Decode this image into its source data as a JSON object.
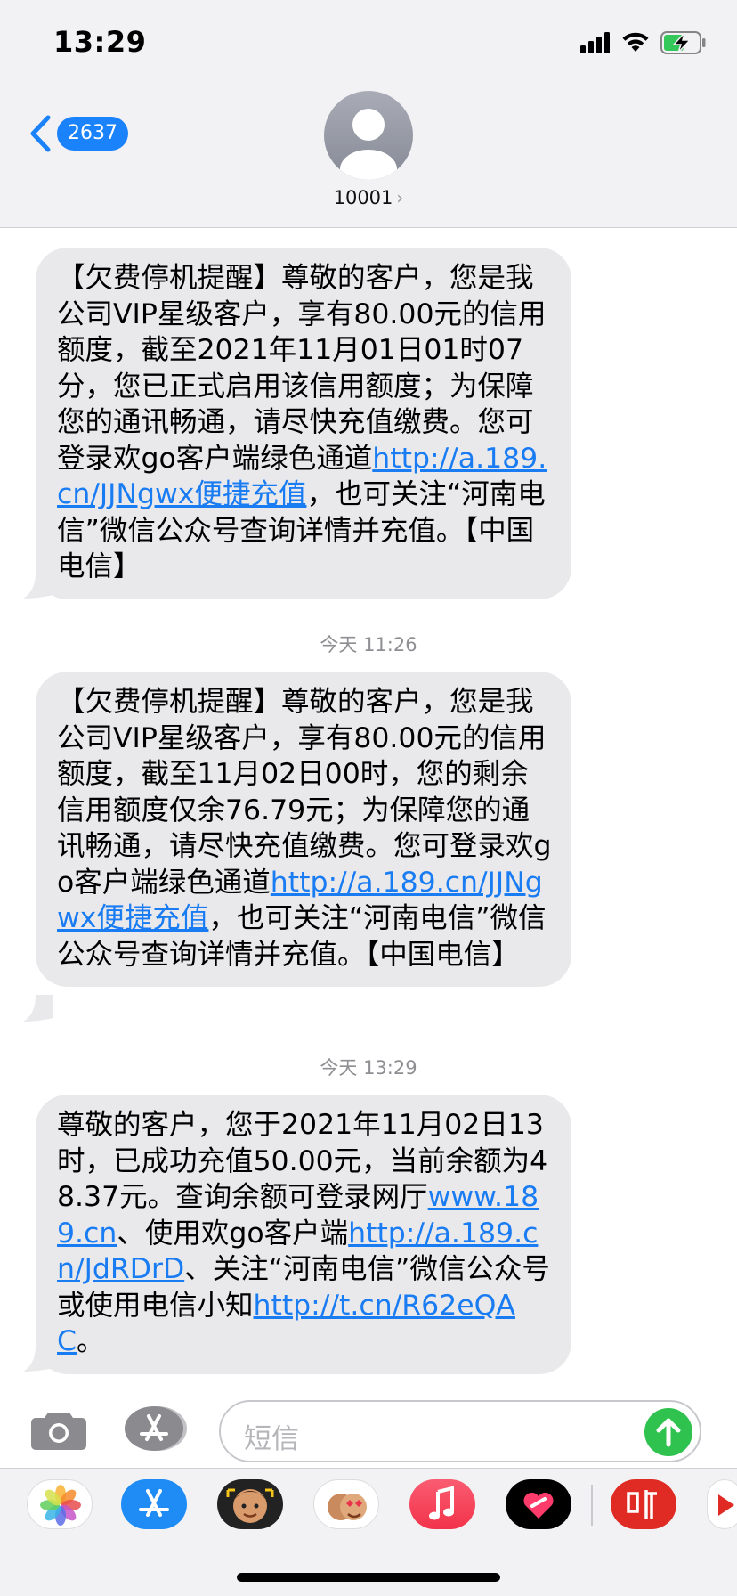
{
  "status_bar": {
    "time": "13:29",
    "icons": [
      "signal-icon",
      "wifi-icon",
      "battery-charging-icon"
    ]
  },
  "header": {
    "unread_count": "2637",
    "contact_name": "10001",
    "contact_chevron": "›"
  },
  "messages": [
    {
      "part1": "【欠费停机提醒】尊敬的客户，您是我公司VIP星级客户，享有80.00元的信用额度，截至2021年11月01日01时07分，您已正式启用该信用额度；为保障您的通讯畅通，请尽快充值缴费。您可登录欢go客户端绿色通道",
      "link1": "http://a.189.cn/JJNgwx便捷充值",
      "part2": "，也可关注“河南电信”微信公众号查询详情并充值。【中国电信】"
    },
    {
      "timestamp": "今天 11:26",
      "part1": "【欠费停机提醒】尊敬的客户，您是我公司VIP星级客户，享有80.00元的信用额度，截至11月02日00时，您的剩余信用额度仅余76.79元；为保障您的通讯畅通，请尽快充值缴费。您可登录欢go客户端绿色通道",
      "link1": "http://a.189.cn/JJNgwx便捷充值",
      "part2": "，也可关注“河南电信”微信公众号查询详情并充值。【中国电信】"
    },
    {
      "timestamp": "今天 13:29",
      "part1": "尊敬的客户，您于2021年11月02日13时，已成功充值50.00元，当前余额为48.37元。查询余额可登录网厅",
      "link1": "www.189.cn",
      "part2": "、使用欢go客户端",
      "link2": "http://a.189.cn/JdRDrD",
      "part3": "、关注“河南电信”微信公众号或使用电信小知",
      "link3": "http://t.cn/R62eQAC",
      "part4": "。"
    }
  ],
  "input": {
    "placeholder": "短信"
  },
  "colors": {
    "bubble": "#e9e9eb",
    "link": "#1a7cf3",
    "badge": "#1a82fb",
    "send": "#2fc24e"
  },
  "app_drawer": [
    "photos-icon",
    "app-store-icon",
    "memoji-icon",
    "memoji-stickers-icon",
    "music-icon",
    "digital-touch-icon",
    "ting-app-icon",
    "partial-app-icon"
  ]
}
